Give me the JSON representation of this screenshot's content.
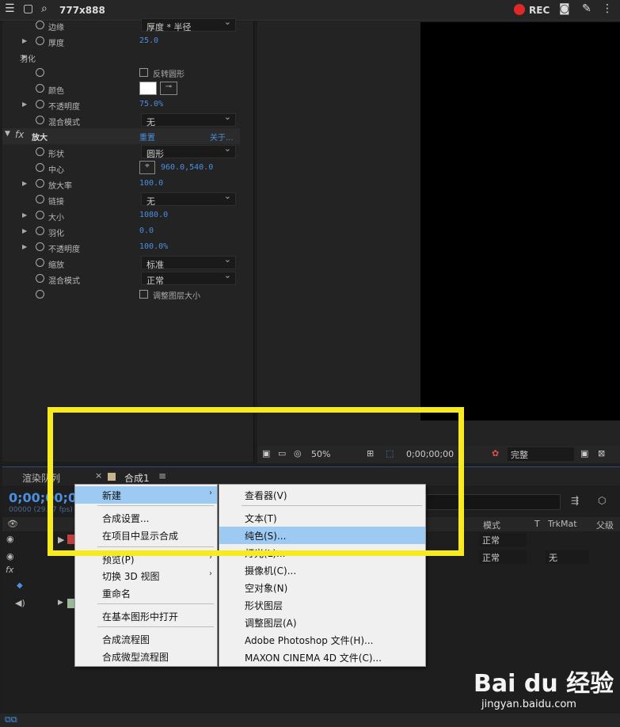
{
  "topbar": {
    "title": "777x888",
    "rec": "REC"
  },
  "effects": {
    "rows": [
      {
        "label": "边缘",
        "dd": "厚度 * 半径"
      },
      {
        "label": "厚度",
        "val": "25.0"
      },
      {
        "label": "羽化"
      },
      {
        "label": "",
        "check": "反转圆形"
      },
      {
        "label": "颜色"
      },
      {
        "label": "不透明度",
        "val": "75.0%"
      },
      {
        "label": "混合模式",
        "dd": "无"
      },
      {
        "label": "放大",
        "reset": "重置",
        "about": "关于..."
      },
      {
        "label": "形状",
        "dd": "圆形"
      },
      {
        "label": "中心",
        "val": "960.0,540.0"
      },
      {
        "label": "放大率",
        "val": "100.0"
      },
      {
        "label": "链接",
        "dd": "无"
      },
      {
        "label": "大小",
        "val": "1080.0"
      },
      {
        "label": "羽化",
        "val": "0.0"
      },
      {
        "label": "不透明度",
        "val": "100.0%"
      },
      {
        "label": "缩放",
        "dd": "标准"
      },
      {
        "label": "混合模式",
        "dd": "正常"
      },
      {
        "label": "",
        "check": "调整图层大小"
      }
    ]
  },
  "viewer": {
    "zoom": "50%",
    "time": "0;00;00;00",
    "quality": "完整"
  },
  "timeline": {
    "tab_render": "渲染队列",
    "tab_comp": "合成1",
    "timecode": "0;00;00;00",
    "frames": "00000 (29.97 fps)",
    "col_mode": "模式",
    "col_t": "T",
    "col_trkmat": "TrkMat",
    "col_parent": "父级",
    "layers": [
      {
        "mode": "正常",
        "trk": ""
      },
      {
        "mode": "正常",
        "trk": "无"
      }
    ]
  },
  "context_menu": {
    "items": [
      "新建",
      "合成设置...",
      "在项目中显示合成",
      "预览(P)",
      "切换 3D 视图",
      "重命名",
      "在基本图形中打开",
      "合成流程图",
      "合成微型流程图"
    ]
  },
  "submenu": {
    "items": [
      "查看器(V)",
      "文本(T)",
      "纯色(S)...",
      "灯光(L)...",
      "摄像机(C)...",
      "空对象(N)",
      "形状图层",
      "调整图层(A)",
      "Adobe Photoshop 文件(H)...",
      "MAXON CINEMA 4D 文件(C)..."
    ]
  },
  "watermark": {
    "brand": "Bai du 经验",
    "url": "jingyan.baidu.com"
  }
}
